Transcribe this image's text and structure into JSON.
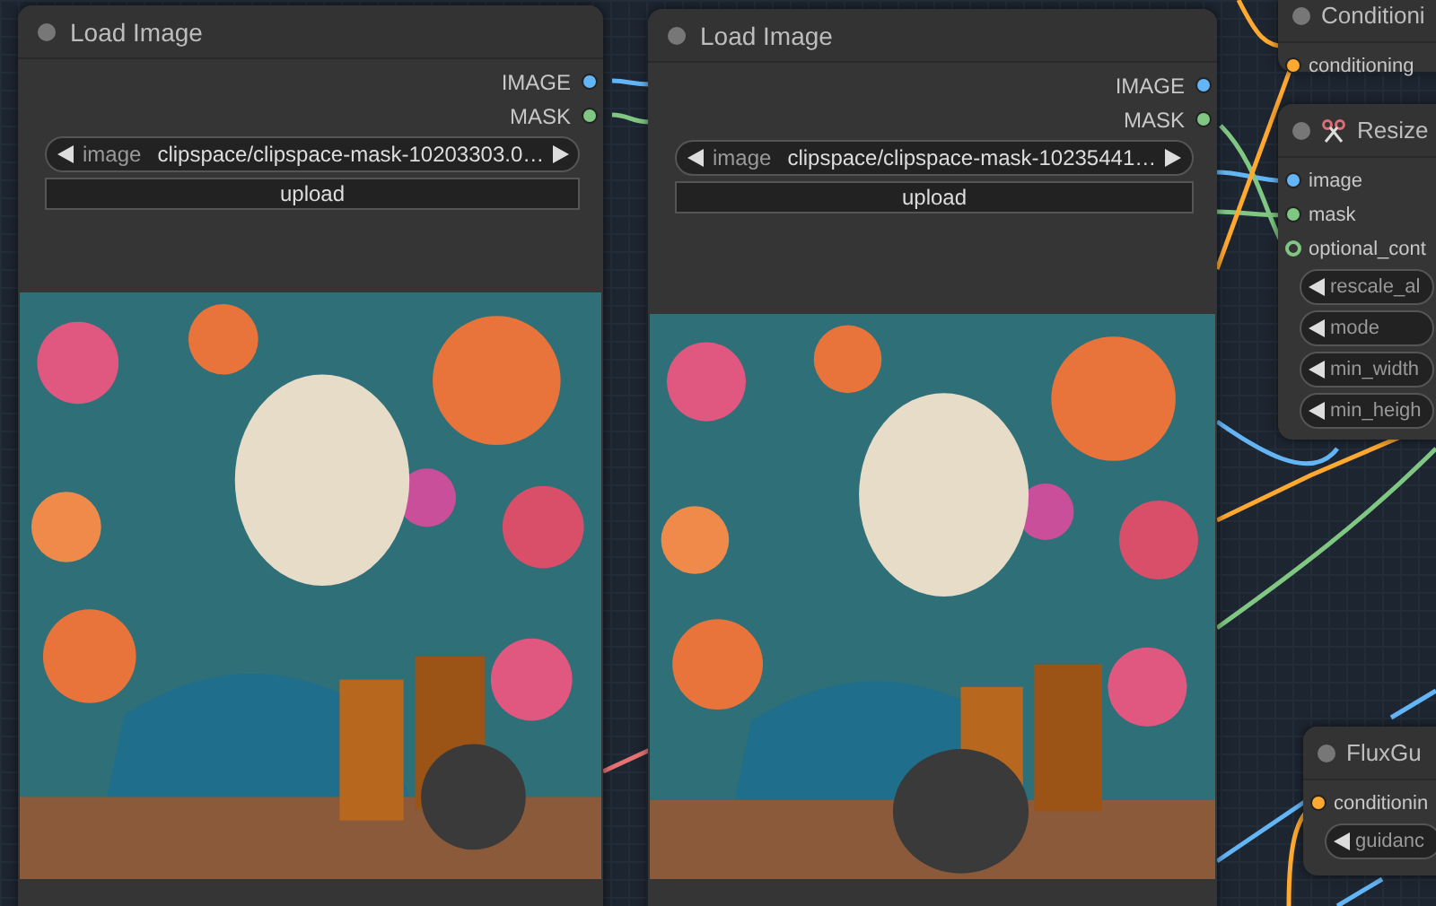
{
  "nodes": [
    {
      "title": "Load Image",
      "outputs": [
        {
          "label": "IMAGE",
          "color": "#64b5f6"
        },
        {
          "label": "MASK",
          "color": "#81c784"
        }
      ],
      "widgets": [
        {
          "kind": "combo",
          "label": "image",
          "value": "clipspace/clipspace-mask-10203303.0…"
        },
        {
          "kind": "button",
          "label": "upload"
        }
      ],
      "preview": {
        "kind": "picture"
      }
    },
    {
      "title": "Load Image",
      "outputs": [
        {
          "label": "IMAGE",
          "color": "#64b5f6"
        },
        {
          "label": "MASK",
          "color": "#81c784"
        }
      ],
      "widgets": [
        {
          "kind": "combo",
          "label": "image",
          "value": "clipspace/clipspace-mask-10235441…"
        },
        {
          "kind": "button",
          "label": "upload"
        }
      ],
      "preview": {
        "kind": "picture"
      }
    },
    {
      "title": "Conditioni",
      "inputs": [
        {
          "label": "conditioning",
          "color": "#ffa931",
          "connected": true
        }
      ]
    },
    {
      "title": "Resize",
      "inputs": [
        {
          "label": "image",
          "color": "#64b5f6",
          "connected": true
        },
        {
          "label": "mask",
          "color": "#81c784",
          "connected": true
        },
        {
          "label": "optional_cont",
          "color": "#81c784",
          "connected": false
        }
      ],
      "widgets": [
        {
          "kind": "combo",
          "label": "rescale_al"
        },
        {
          "kind": "combo",
          "label": "mode"
        },
        {
          "kind": "combo",
          "label": "min_width"
        },
        {
          "kind": "combo",
          "label": "min_heigh"
        }
      ]
    },
    {
      "title": "FluxGu",
      "inputs": [
        {
          "label": "conditionin",
          "color": "#ffa931",
          "connected": true
        }
      ],
      "widgets": [
        {
          "kind": "combo",
          "label": "guidanc"
        }
      ]
    }
  ]
}
